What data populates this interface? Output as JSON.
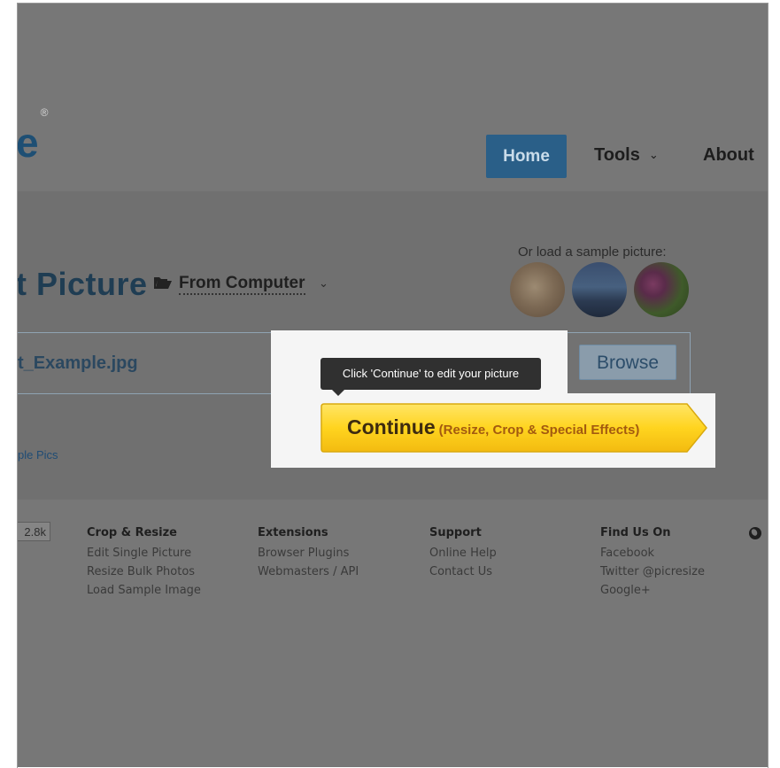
{
  "header": {
    "logo_text": "e",
    "logo_mark": "®",
    "nav": {
      "home": "Home",
      "tools": "Tools",
      "about": "About"
    }
  },
  "upload": {
    "title": "t Picture",
    "source_label": "From Computer",
    "file_name": "t_Example.jpg",
    "browse_label": "Browse",
    "sample_link": "ple Pics"
  },
  "samples": {
    "label": "Or load a sample picture:",
    "items": [
      "dog-photo",
      "city-skyline-photo",
      "pink-flower-photo"
    ]
  },
  "tooltip": {
    "text": "Click 'Continue' to edit your picture"
  },
  "continue_button": {
    "label": "Continue",
    "sub_label": "(Resize, Crop & Special Effects)"
  },
  "footer": {
    "counter": "2.8k",
    "columns": [
      {
        "heading": "Crop & Resize",
        "links": [
          "Edit Single Picture",
          "Resize Bulk Photos",
          "Load Sample Image"
        ]
      },
      {
        "heading": "Extensions",
        "links": [
          "Browser Plugins",
          "Webmasters / API"
        ]
      },
      {
        "heading": "Support",
        "links": [
          "Online Help",
          "Contact Us"
        ]
      },
      {
        "heading": "Find Us On",
        "links": [
          "Facebook",
          "Twitter @picresize",
          "Google+"
        ]
      }
    ]
  },
  "colors": {
    "overlay": "#777777",
    "accent_button": "#2a5f88",
    "continue_yellow": "#ffd226",
    "tooltip_bg": "#303030"
  }
}
